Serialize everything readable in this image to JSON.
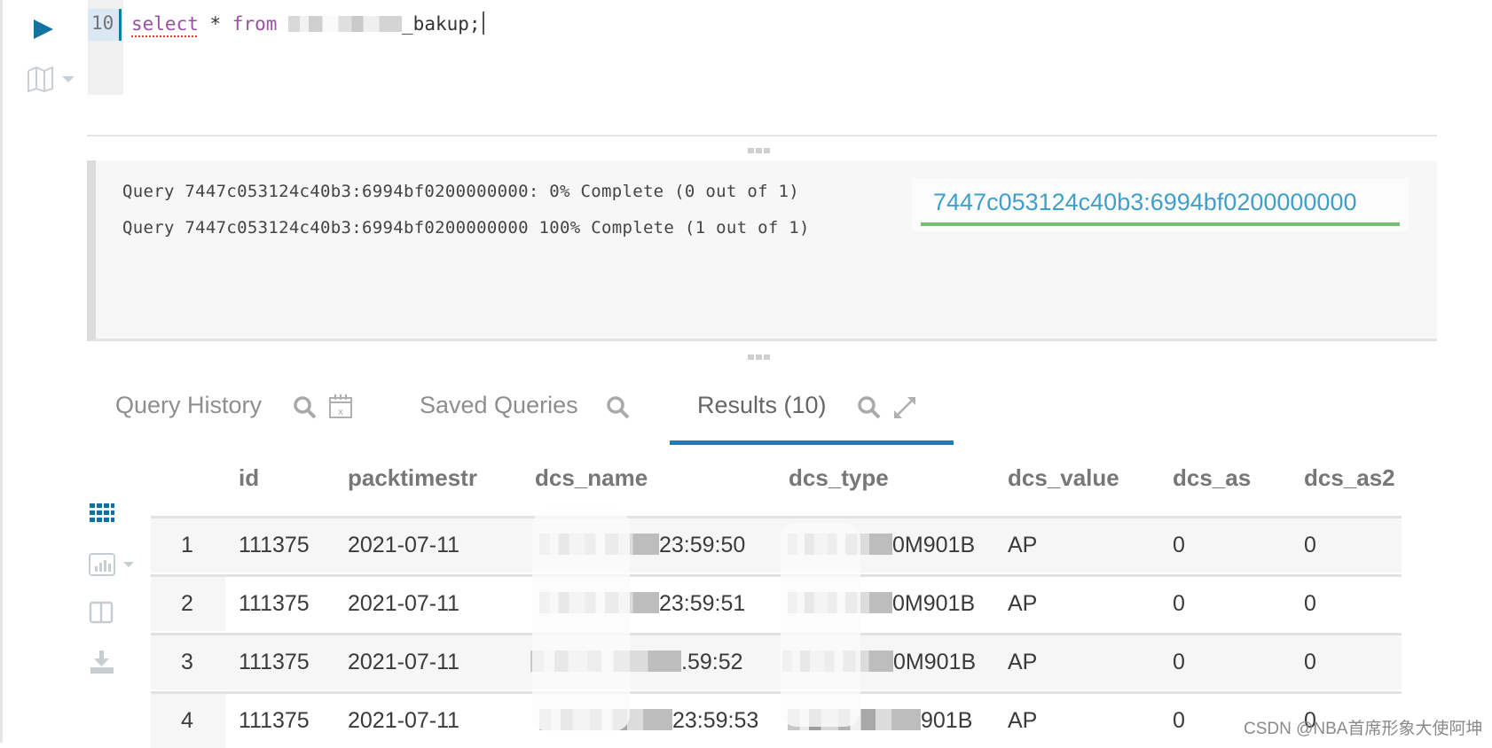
{
  "editor": {
    "line_number": "10",
    "code": {
      "keyword_select": "select",
      "star": " * ",
      "keyword_from": "from",
      "table_suffix": "_bakup;"
    },
    "run_icon": "play-icon",
    "snippets_icon": "map-icon"
  },
  "log": {
    "lines": [
      "Query 7447c053124c40b3:6994bf0200000000: 0% Complete (0 out of 1)",
      "Query 7447c053124c40b3:6994bf0200000000 100% Complete (1 out of 1)"
    ],
    "job_link": "7447c053124c40b3:6994bf0200000000",
    "job_progress_percent": 100,
    "colors": {
      "link": "#3f9fc9",
      "progress": "#74bf72"
    }
  },
  "tabs": [
    {
      "label": "Query History",
      "active": false,
      "icons": [
        "search-icon",
        "calendar-clear-icon"
      ]
    },
    {
      "label": "Saved Queries",
      "active": false,
      "icons": [
        "search-icon"
      ]
    },
    {
      "label": "Results (10)",
      "active": true,
      "icons": [
        "search-icon",
        "expand-icon"
      ]
    }
  ],
  "side_toolbar": [
    "grid-icon",
    "bar-chart-icon",
    "columns-icon",
    "download-icon"
  ],
  "table": {
    "columns": [
      "",
      "id",
      "packtimestr",
      "dcs_name",
      "dcs_type",
      "dcs_value",
      "dcs_as",
      "dcs_as2"
    ],
    "rows": [
      {
        "index": "1",
        "id": "111375",
        "packtimestr": "2021-07-11",
        "dcs_name_visible": "23:59:50",
        "dcs_type_visible": "0M901B",
        "dcs_value": "AP",
        "dcs_as": "0",
        "dcs_as2": "0"
      },
      {
        "index": "2",
        "id": "111375",
        "packtimestr": "2021-07-11",
        "dcs_name_visible": "23:59:51",
        "dcs_type_visible": "0M901B",
        "dcs_value": "AP",
        "dcs_as": "0",
        "dcs_as2": "0"
      },
      {
        "index": "3",
        "id": "111375",
        "packtimestr": "2021-07-11",
        "dcs_name_visible": ".59:52",
        "dcs_type_visible": "0M901B",
        "dcs_value": "AP",
        "dcs_as": "0",
        "dcs_as2": "0"
      },
      {
        "index": "4",
        "id": "111375",
        "packtimestr": "2021-07-11",
        "dcs_name_visible": "23:59:53",
        "dcs_type_visible": "901B",
        "dcs_value": "AP",
        "dcs_as": "0",
        "dcs_as2": "0"
      }
    ]
  },
  "accent_color": "#1a80b3",
  "watermark": "CSDN @NBA首席形象大使阿坤"
}
